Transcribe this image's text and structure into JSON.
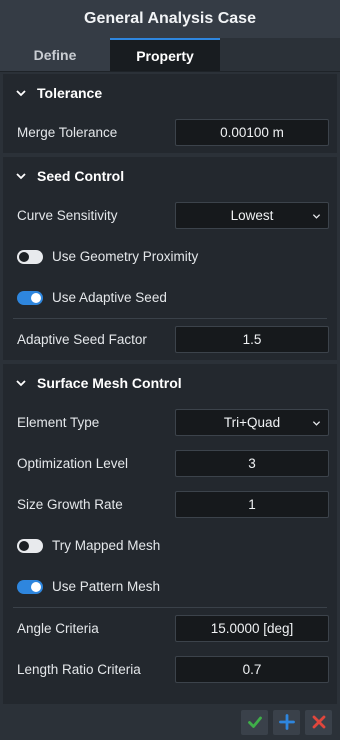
{
  "window": {
    "title": "General Analysis Case"
  },
  "tabs": [
    {
      "label": "Define",
      "active": false
    },
    {
      "label": "Property",
      "active": true
    }
  ],
  "tolerance": {
    "title": "Tolerance",
    "merge_label": "Merge Tolerance",
    "merge_value": "0.00100 m"
  },
  "seed": {
    "title": "Seed Control",
    "curve_label": "Curve Sensitivity",
    "curve_value": "Lowest",
    "geom_label": "Use Geometry Proximity",
    "geom_on": false,
    "adaptive_label": "Use Adaptive Seed",
    "adaptive_on": true,
    "factor_label": "Adaptive Seed Factor",
    "factor_value": "1.5"
  },
  "surface": {
    "title": "Surface Mesh Control",
    "element_label": "Element Type",
    "element_value": "Tri+Quad",
    "opt_label": "Optimization Level",
    "opt_value": "3",
    "growth_label": "Size Growth Rate",
    "growth_value": "1",
    "mapped_label": "Try Mapped Mesh",
    "mapped_on": false,
    "pattern_label": "Use Pattern Mesh",
    "pattern_on": true,
    "angle_label": "Angle Criteria",
    "angle_value": "15.0000 [deg]",
    "ratio_label": "Length Ratio Criteria",
    "ratio_value": "0.7"
  },
  "footer": {
    "icons": [
      "check-icon",
      "plus-icon",
      "close-icon"
    ]
  },
  "colors": {
    "accent": "#2e86de",
    "ok": "#3fae49",
    "cancel": "#e0463c"
  }
}
